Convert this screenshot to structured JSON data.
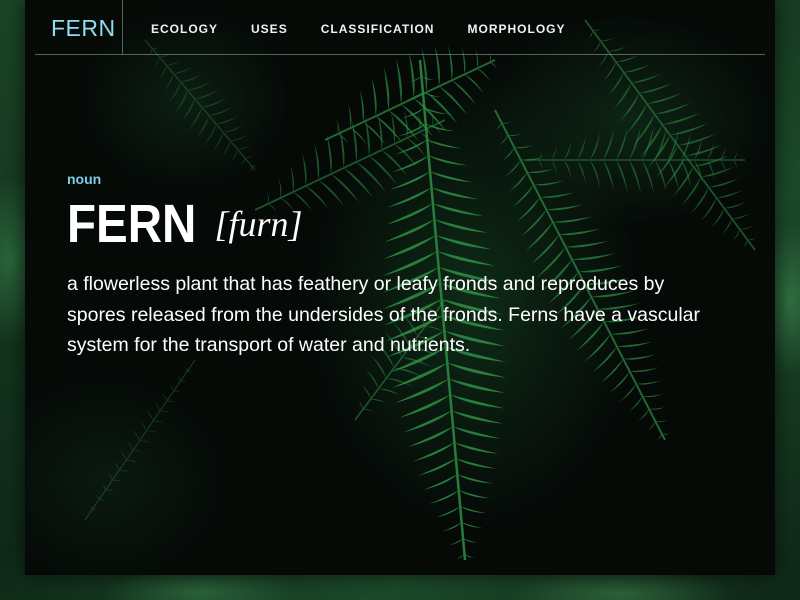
{
  "nav": {
    "brand": "FERN",
    "links": [
      {
        "label": "ECOLOGY"
      },
      {
        "label": "USES"
      },
      {
        "label": "CLASSIFICATION"
      },
      {
        "label": "MORPHOLOGY"
      }
    ]
  },
  "entry": {
    "part_of_speech": "noun",
    "word": "FERN",
    "pronunciation": "[furn]",
    "definition": "a flowerless plant that has feathery or leafy fronds and reproduces by spores released from the undersides of the fronds. Ferns have a vascular system for the transport of water and nutrients."
  },
  "colors": {
    "brand": "#8fdcf5",
    "part_of_speech": "#7fcbe6",
    "text": "#ffffff",
    "card_background": "#050a07",
    "frond": "#2f8f45"
  },
  "background": {
    "subject": "fern-fronds-photo"
  }
}
